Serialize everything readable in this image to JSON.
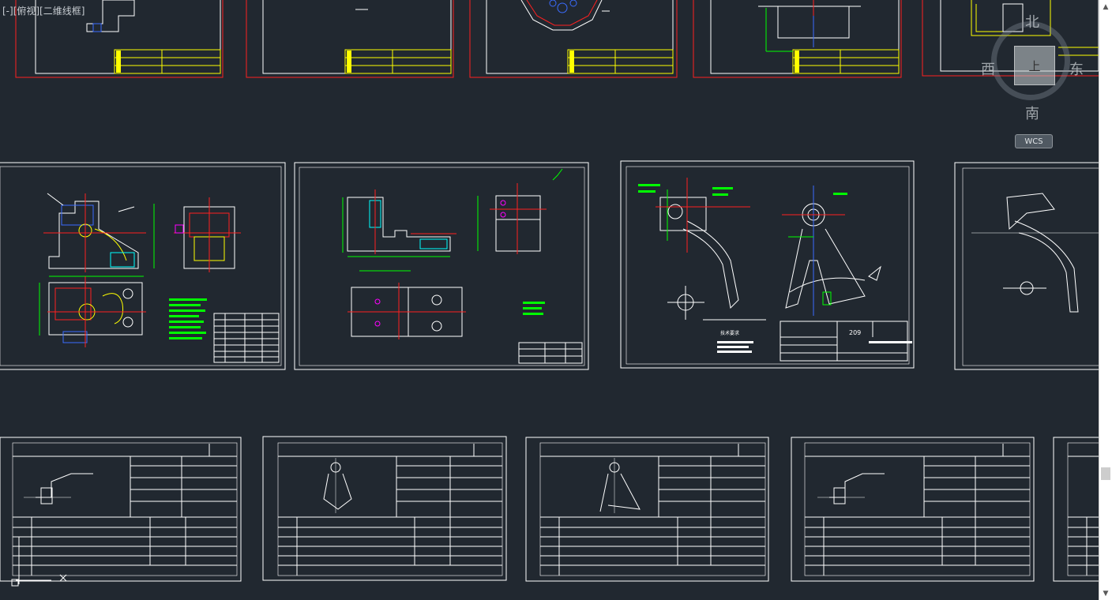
{
  "viewport": {
    "label": "[-][俯视][二维线框]"
  },
  "viewcube": {
    "face": "上",
    "north": "北",
    "south": "南",
    "east": "东",
    "west": "西",
    "wcs": "WCS"
  },
  "drawing_texts": {
    "tech_req": "技术要求",
    "part_no": "209"
  },
  "colors": {
    "background": "#212830",
    "line": "#ffffff",
    "dimension": "#00ff00",
    "center": "#ff0000",
    "titleblock": "#ffff00",
    "accent": "#ff00ff"
  },
  "scrollbar": {
    "up": "▲",
    "down": "▼"
  }
}
